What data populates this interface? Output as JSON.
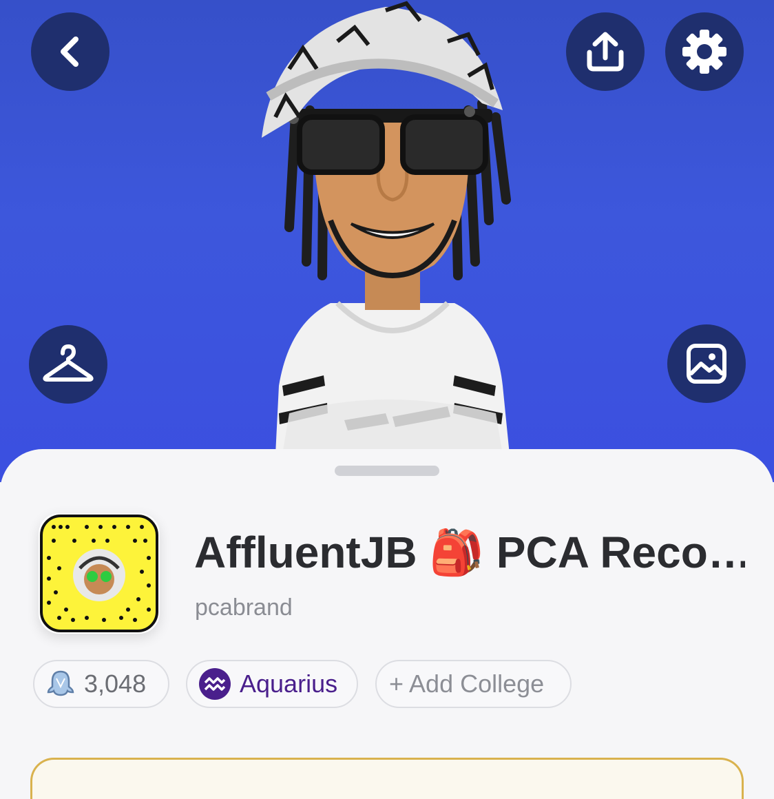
{
  "header": {
    "back_icon": "chevron-left-icon",
    "share_icon": "upload-share-icon",
    "settings_icon": "gear-icon",
    "outfit_icon": "hanger-icon",
    "photo_icon": "image-frame-icon",
    "background_color": "#3d57dc",
    "button_color": "#1f2f6e"
  },
  "profile": {
    "display_name": "AffluentJB 🎒 PCA Reco…",
    "username": "pcabrand",
    "snapcode_color": "#fdf33a"
  },
  "badges": {
    "score": "3,048",
    "zodiac": "Aquarius",
    "college": "+ Add College",
    "zodiac_color": "#4a1f8c"
  }
}
